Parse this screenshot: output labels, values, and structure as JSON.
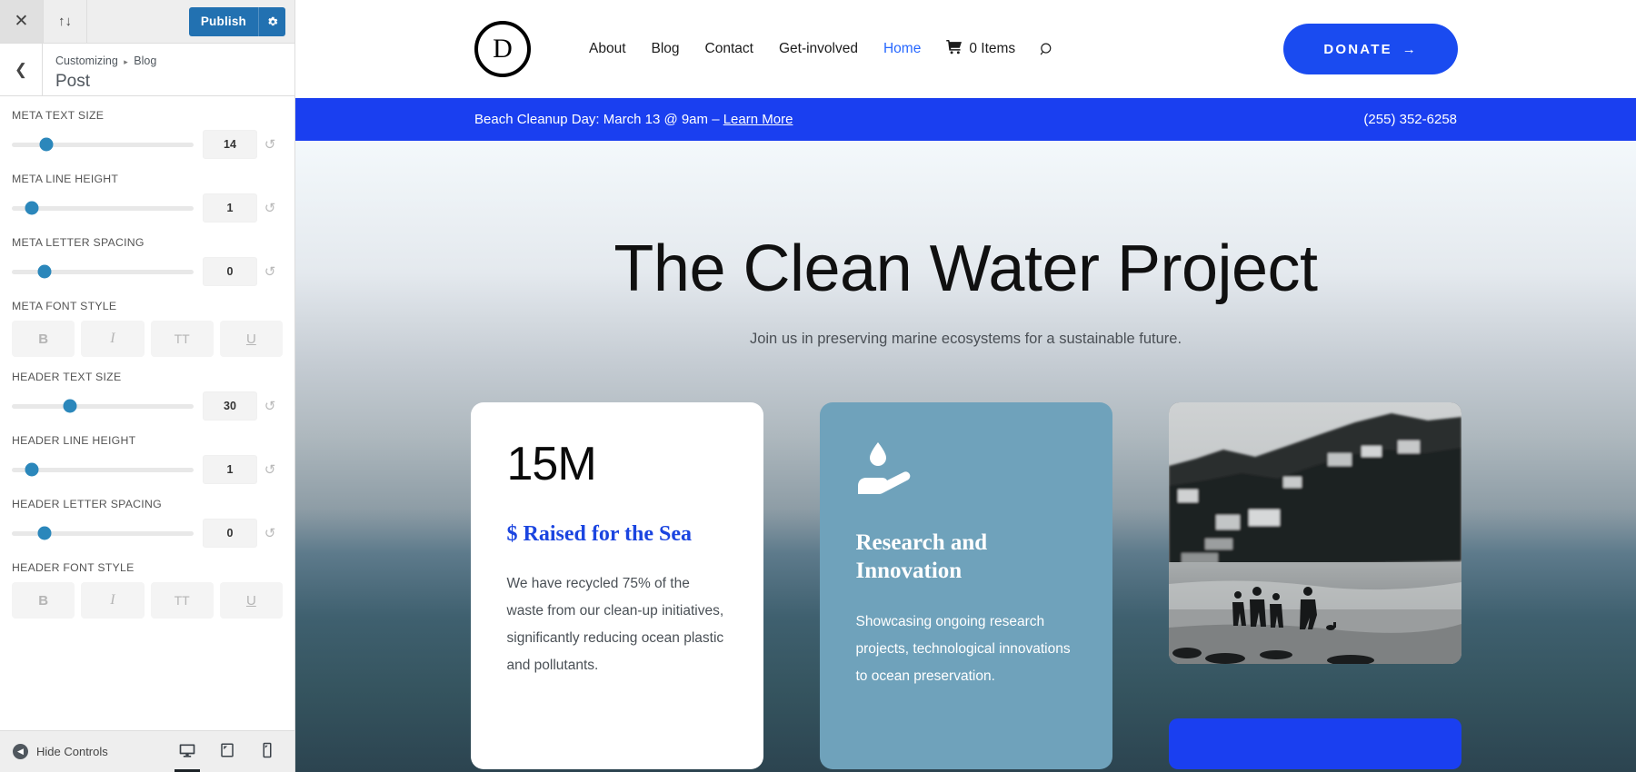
{
  "customizer": {
    "topbar": {
      "close_icon": "close-icon",
      "updown_icon": "collapse-expand-icon",
      "publish_label": "Publish",
      "gear_icon": "gear-icon"
    },
    "header": {
      "back_icon": "chevron-left-icon",
      "breadcrumb_root": "Customizing",
      "breadcrumb_separator": "▸",
      "breadcrumb_section": "Blog",
      "panel_title": "Post"
    },
    "controls": [
      {
        "label": "META TEXT SIZE",
        "value": "14",
        "thumb_pct": 19
      },
      {
        "label": "META LINE HEIGHT",
        "value": "1",
        "thumb_pct": 11
      },
      {
        "label": "META LETTER SPACING",
        "value": "0",
        "thumb_pct": 18
      },
      {
        "label": "HEADER TEXT SIZE",
        "value": "30",
        "thumb_pct": 32
      },
      {
        "label": "HEADER LINE HEIGHT",
        "value": "1",
        "thumb_pct": 11
      },
      {
        "label": "HEADER LETTER SPACING",
        "value": "0",
        "thumb_pct": 18
      }
    ],
    "font_style_groups": [
      {
        "label": "META FONT STYLE",
        "buttons": [
          "B",
          "I",
          "TT",
          "U"
        ]
      },
      {
        "label": "HEADER FONT STYLE",
        "buttons": [
          "B",
          "I",
          "TT",
          "U"
        ]
      }
    ],
    "reset_icon": "reset-arrow-icon",
    "footer": {
      "hide_controls_label": "Hide Controls",
      "devices": [
        {
          "name": "desktop",
          "active": true
        },
        {
          "name": "tablet",
          "active": false
        },
        {
          "name": "mobile",
          "active": false
        }
      ]
    }
  },
  "site": {
    "logo_letter": "D",
    "nav": [
      {
        "label": "About",
        "current": false
      },
      {
        "label": "Blog",
        "current": false
      },
      {
        "label": "Contact",
        "current": false
      },
      {
        "label": "Get-involved",
        "current": false
      },
      {
        "label": "Home",
        "current": true
      }
    ],
    "cart_label": "0 Items",
    "cart_icon": "shopping-cart-icon",
    "search_icon": "search-icon",
    "donate_label": "DONATE",
    "donate_arrow": "→",
    "announcement": {
      "text": "Beach Cleanup Day: March 13 @ 9am – ",
      "link_label": "Learn More",
      "phone": "(255) 352-6258"
    },
    "hero": {
      "title": "The Clean Water Project",
      "subtitle": "Join us in preserving marine ecosystems for a sustainable future."
    },
    "cards": [
      {
        "type": "stat",
        "stat": "15M",
        "subtitle": "$ Raised for the Sea",
        "body": "We have recycled 75% of the waste from our clean-up initiatives, significantly reducing ocean plastic and pollutants."
      },
      {
        "type": "feature",
        "icon": "water-drop-in-hand-icon",
        "title": "Research and Innovation",
        "body": "Showcasing ongoing research projects, technological innovations to ocean preservation."
      },
      {
        "type": "image",
        "alt": "People walking on a beach with hillside houses in black and white"
      }
    ]
  },
  "colors": {
    "accent_blue": "#1a3ff0",
    "publish_blue": "#2271b1",
    "slider_blue": "#2b87bb",
    "card_blue": "#6fa2bb",
    "link_blue": "#2667ff",
    "serif_blue": "#1b45e0"
  }
}
